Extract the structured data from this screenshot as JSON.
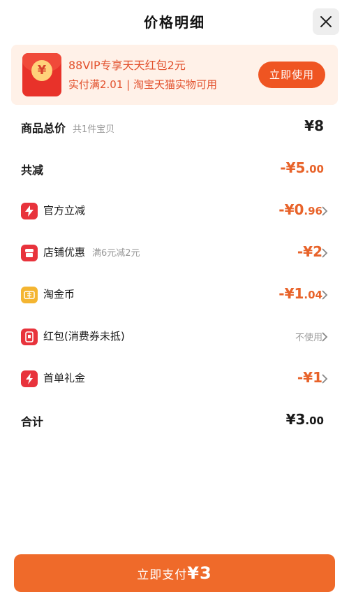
{
  "header": {
    "title": "价格明细"
  },
  "promo": {
    "icon_glyph": "¥",
    "line1": "88VIP专享天天红包2元",
    "line2": "实付满2.01 | 淘宝天猫实物可用",
    "button_label": "立即使用"
  },
  "rows": {
    "total": {
      "label": "商品总价",
      "note": "共1件宝贝",
      "value": "¥8"
    },
    "discount": {
      "label": "共减",
      "value_main": "-¥5",
      "value_dec": ".00"
    },
    "official": {
      "label": "官方立减",
      "value_main": "-¥0",
      "value_dec": ".96",
      "icon": "bolt-icon",
      "icon_color": "#e8333c"
    },
    "shop": {
      "label": "店铺优惠",
      "note": "满6元减2元",
      "value_main": "-¥2",
      "value_dec": "",
      "icon": "shop-icon",
      "icon_color": "#e8333c"
    },
    "coin": {
      "label": "淘金币",
      "value_main": "-¥1",
      "value_dec": ".04",
      "icon": "coin-icon",
      "icon_color": "#f4b531"
    },
    "redpacket": {
      "label": "红包(消费券未抵)",
      "value_text": "不使用",
      "icon": "red-packet-icon",
      "icon_color": "#e8333c"
    },
    "firstorder": {
      "label": "首单礼金",
      "value_main": "-¥1",
      "value_dec": "",
      "icon": "gift-bolt-icon",
      "icon_color": "#e8333c"
    },
    "sum": {
      "label": "合计",
      "value_main": "¥3",
      "value_dec": ".00"
    }
  },
  "pay": {
    "label": "立即支付",
    "amount": "¥3"
  },
  "colors": {
    "accent": "#ef6a2a",
    "price_orange": "#e8632a",
    "promo_bg": "#fff1e8"
  }
}
